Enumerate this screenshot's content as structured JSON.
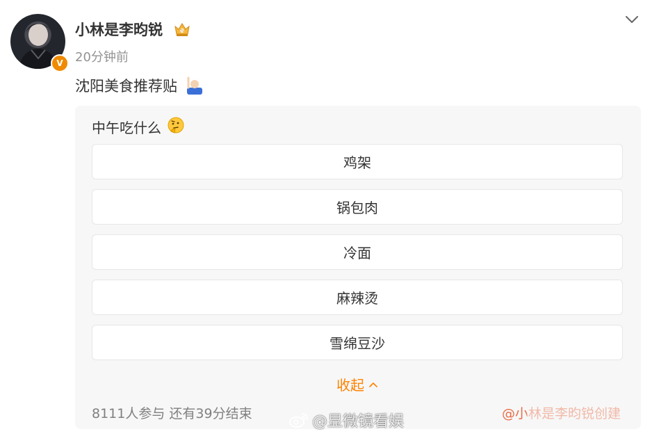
{
  "post": {
    "username": "小林是李昀锐",
    "timestamp": "20分钟前",
    "text": "沈阳美食推荐贴",
    "avatar_badge": "V"
  },
  "poll": {
    "question": "中午吃什么",
    "options": [
      {
        "label": "鸡架"
      },
      {
        "label": "锅包肉"
      },
      {
        "label": "冷面"
      },
      {
        "label": "麻辣烫"
      },
      {
        "label": "雪绵豆沙"
      }
    ],
    "collapse_label": "收起",
    "stats": "8111人参与 还有39分结束",
    "source": "@小林是李昀锐创建"
  },
  "watermark": {
    "text": "@显微镜看娱"
  },
  "icons": {
    "chevron": "chevron-down-icon",
    "crown_badge": "crown-badge-icon",
    "post_emoji": "raising-hand-emoji-icon",
    "question_emoji": "thinking-face-emoji-icon",
    "collapse": "chevron-up-icon",
    "weibo": "weibo-logo-icon"
  },
  "colors": {
    "accent": "#ff8200",
    "source_link": "#e86d48",
    "verified": "#f08a00",
    "muted_text": "#939393",
    "card_bg": "#f7f7f7"
  }
}
